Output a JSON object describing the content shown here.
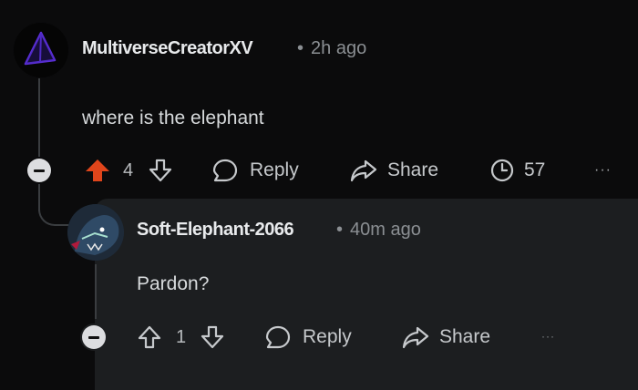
{
  "parent": {
    "username": "MultiverseCreatorXV",
    "time": "2h ago",
    "body": "where is the elephant",
    "votes": "4",
    "reply_label": "Reply",
    "share_label": "Share",
    "awards": "57",
    "more": "···"
  },
  "reply": {
    "username": "Soft-Elephant-2066",
    "time": "40m ago",
    "body": "Pardon?",
    "votes": "1",
    "reply_label": "Reply",
    "share_label": "Share",
    "more": "···"
  },
  "colors": {
    "upvote_active": "#e0451b",
    "background": "#0b0b0c",
    "reply_panel": "#1c1e20",
    "avatar_purple": "#5a2fd6"
  },
  "icons": [
    "pyramid-avatar-icon",
    "upvote-icon",
    "downvote-icon",
    "comment-icon",
    "share-arrow-icon",
    "award-clock-icon",
    "more-icon",
    "collapse-icon"
  ]
}
